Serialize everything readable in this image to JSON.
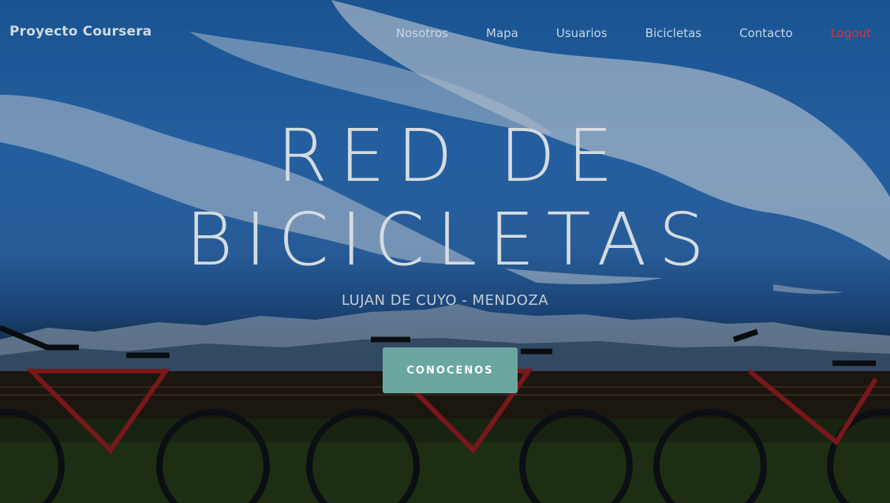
{
  "navbar": {
    "brand": "Proyecto Coursera",
    "links": [
      {
        "label": "Nosotros"
      },
      {
        "label": "Mapa"
      },
      {
        "label": "Usuarios"
      },
      {
        "label": "Bicicletas"
      },
      {
        "label": "Contacto"
      },
      {
        "label": "Logout"
      }
    ]
  },
  "hero": {
    "title_line1": "RED DE",
    "title_line2": "BICICLETAS",
    "subtitle": "LUJAN DE CUYO - MENDOZA",
    "cta_label": "CONOCENOS"
  },
  "colors": {
    "accent": "#6aa7a1",
    "logout": "#d9343d",
    "headline": "#d5dbe0"
  }
}
